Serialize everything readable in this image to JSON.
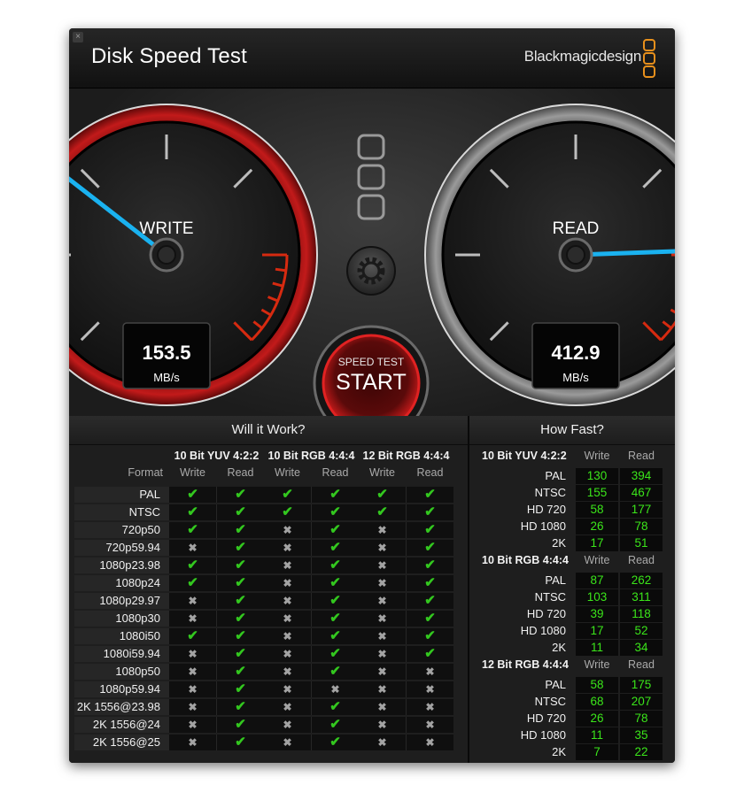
{
  "window": {
    "title": "Disk Speed Test",
    "brand": "Blackmagicdesign",
    "close_glyph": "×"
  },
  "gauges": {
    "write": {
      "label": "WRITE",
      "value": "153.5",
      "unit": "MB/s",
      "reading": 153.5
    },
    "read": {
      "label": "READ",
      "value": "412.9",
      "unit": "MB/s",
      "reading": 412.9
    }
  },
  "controls": {
    "start_top": "SPEED TEST",
    "start_main": "START",
    "settings_icon": "gear-icon"
  },
  "will_it_work": {
    "title": "Will it Work?",
    "format_label": "Format",
    "groups": [
      "10 Bit YUV 4:2:2",
      "10 Bit RGB 4:4:4",
      "12 Bit RGB 4:4:4"
    ],
    "write_label": "Write",
    "read_label": "Read",
    "rows": [
      {
        "format": "PAL",
        "cells": [
          1,
          1,
          1,
          1,
          1,
          1
        ]
      },
      {
        "format": "NTSC",
        "cells": [
          1,
          1,
          1,
          1,
          1,
          1
        ]
      },
      {
        "format": "720p50",
        "cells": [
          1,
          1,
          0,
          1,
          0,
          1
        ]
      },
      {
        "format": "720p59.94",
        "cells": [
          0,
          1,
          0,
          1,
          0,
          1
        ]
      },
      {
        "format": "1080p23.98",
        "cells": [
          1,
          1,
          0,
          1,
          0,
          1
        ]
      },
      {
        "format": "1080p24",
        "cells": [
          1,
          1,
          0,
          1,
          0,
          1
        ]
      },
      {
        "format": "1080p29.97",
        "cells": [
          0,
          1,
          0,
          1,
          0,
          1
        ]
      },
      {
        "format": "1080p30",
        "cells": [
          0,
          1,
          0,
          1,
          0,
          1
        ]
      },
      {
        "format": "1080i50",
        "cells": [
          1,
          1,
          0,
          1,
          0,
          1
        ]
      },
      {
        "format": "1080i59.94",
        "cells": [
          0,
          1,
          0,
          1,
          0,
          1
        ]
      },
      {
        "format": "1080p50",
        "cells": [
          0,
          1,
          0,
          1,
          0,
          0
        ]
      },
      {
        "format": "1080p59.94",
        "cells": [
          0,
          1,
          0,
          0,
          0,
          0
        ]
      },
      {
        "format": "2K 1556@23.98",
        "cells": [
          0,
          1,
          0,
          1,
          0,
          0
        ]
      },
      {
        "format": "2K 1556@24",
        "cells": [
          0,
          1,
          0,
          1,
          0,
          0
        ]
      },
      {
        "format": "2K 1556@25",
        "cells": [
          0,
          1,
          0,
          1,
          0,
          0
        ]
      }
    ]
  },
  "how_fast": {
    "title": "How Fast?",
    "write_label": "Write",
    "read_label": "Read",
    "groups": [
      {
        "name": "10 Bit YUV 4:2:2",
        "rows": [
          {
            "format": "PAL",
            "write": "130",
            "read": "394"
          },
          {
            "format": "NTSC",
            "write": "155",
            "read": "467"
          },
          {
            "format": "HD 720",
            "write": "58",
            "read": "177"
          },
          {
            "format": "HD 1080",
            "write": "26",
            "read": "78"
          },
          {
            "format": "2K",
            "write": "17",
            "read": "51"
          }
        ]
      },
      {
        "name": "10 Bit RGB 4:4:4",
        "rows": [
          {
            "format": "PAL",
            "write": "87",
            "read": "262"
          },
          {
            "format": "NTSC",
            "write": "103",
            "read": "311"
          },
          {
            "format": "HD 720",
            "write": "39",
            "read": "118"
          },
          {
            "format": "HD 1080",
            "write": "17",
            "read": "52"
          },
          {
            "format": "2K",
            "write": "11",
            "read": "34"
          }
        ]
      },
      {
        "name": "12 Bit RGB 4:4:4",
        "rows": [
          {
            "format": "PAL",
            "write": "58",
            "read": "175"
          },
          {
            "format": "NTSC",
            "write": "68",
            "read": "207"
          },
          {
            "format": "HD 720",
            "write": "26",
            "read": "78"
          },
          {
            "format": "HD 1080",
            "write": "11",
            "read": "35"
          },
          {
            "format": "2K",
            "write": "7",
            "read": "22"
          }
        ]
      }
    ]
  }
}
